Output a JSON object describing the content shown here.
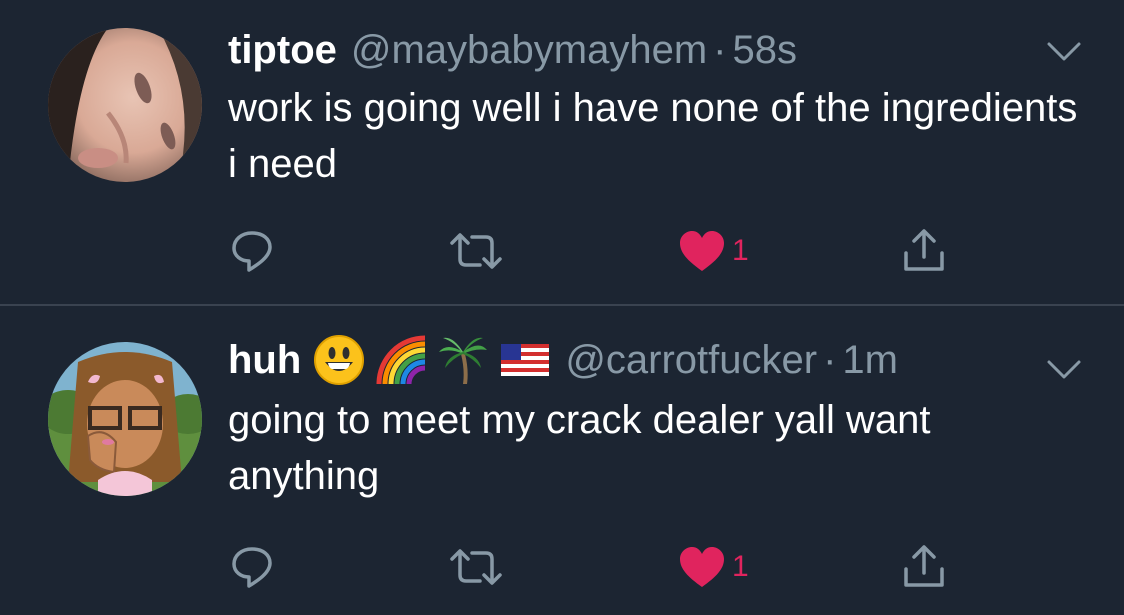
{
  "colors": {
    "background": "#1c2532",
    "secondary_text": "#8899a6",
    "like": "#e0245e",
    "divider": "#3a4350"
  },
  "tweets": [
    {
      "display_name": "tiptoe",
      "handle": "@maybabymayhem",
      "separator": "·",
      "time": "58s",
      "text": "work is going well i have none of the ingredients i need",
      "like_count": "1",
      "avatar": "profile-photo-face",
      "name_emojis": []
    },
    {
      "display_name": "huh",
      "handle": "@carrotfucker",
      "separator": "·",
      "time": "1m",
      "text": "going to meet my crack dealer yall want anything",
      "like_count": "1",
      "avatar": "cartoon-girl-with-glasses",
      "name_emojis": [
        "smiley-face-emoji",
        "rainbow-emoji",
        "palm-tree-emoji",
        "us-flag-emoji"
      ]
    }
  ],
  "icons": [
    "reply-icon",
    "retweet-icon",
    "heart-icon",
    "share-icon",
    "chevron-down-icon"
  ]
}
